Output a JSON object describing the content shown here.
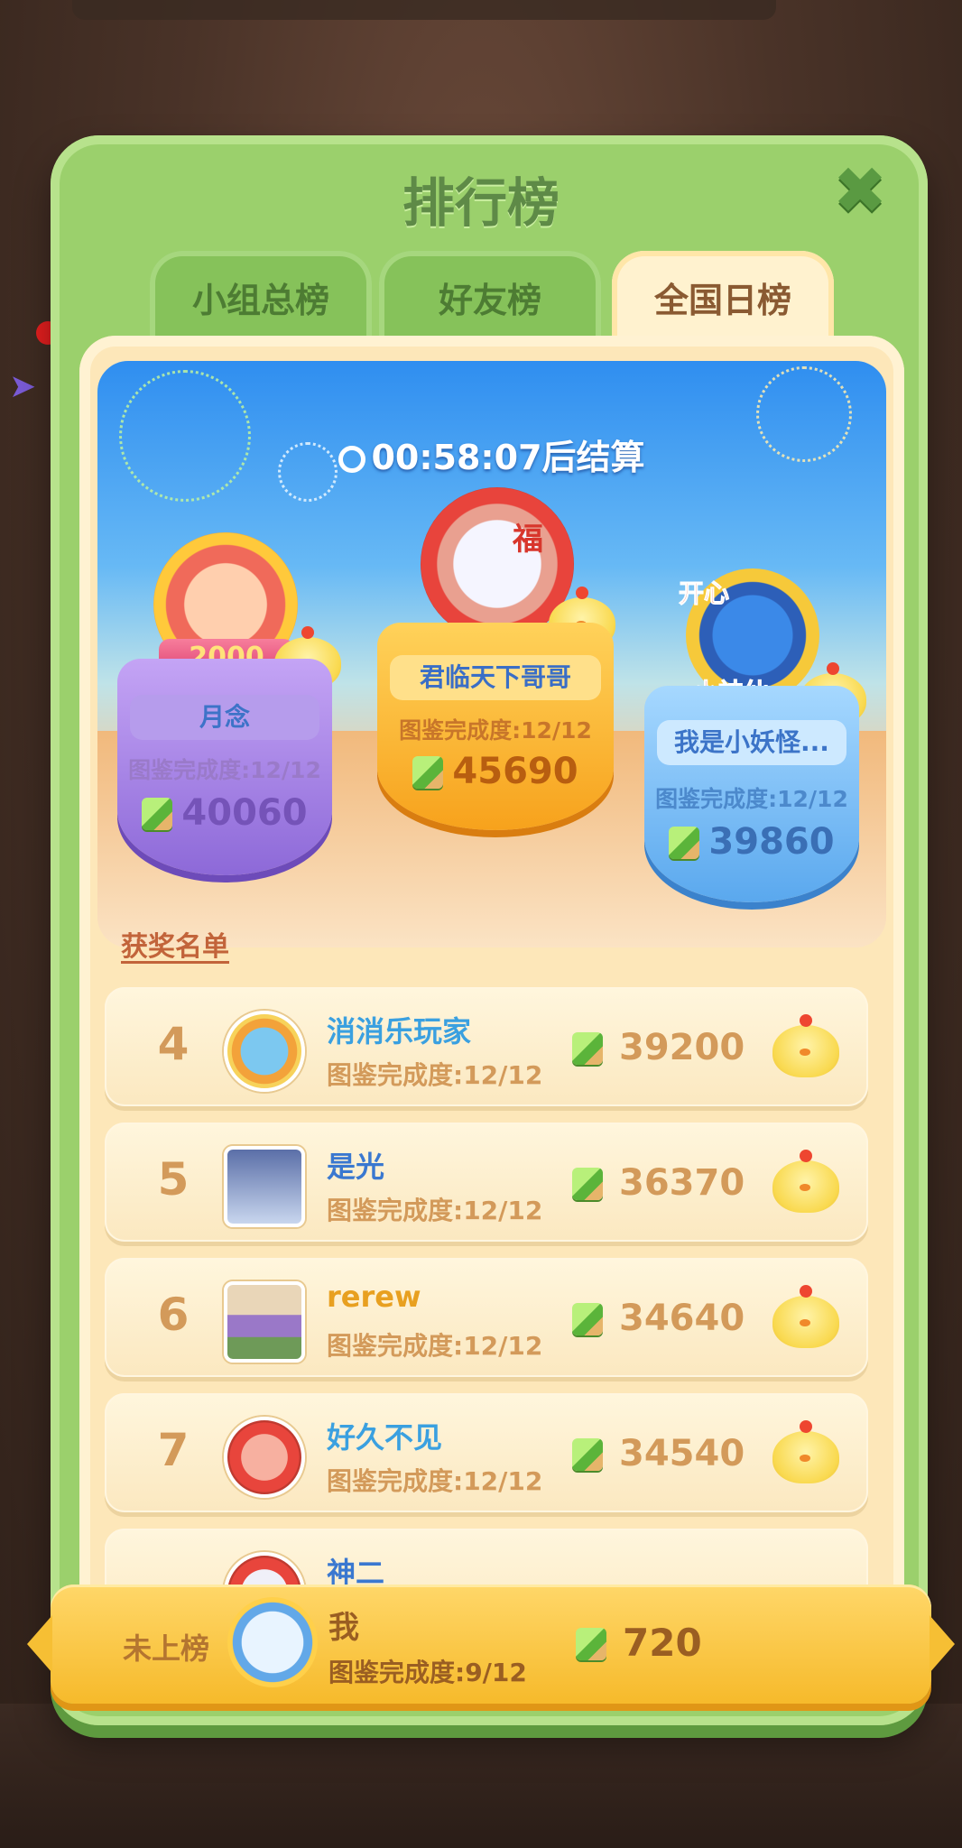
{
  "panel": {
    "title": "排行榜"
  },
  "tabs": [
    {
      "label": "小组总榜",
      "active": false
    },
    {
      "label": "好友榜",
      "active": false
    },
    {
      "label": "全国日榜",
      "active": true
    }
  ],
  "timer": {
    "text": "00:58:07后结算"
  },
  "podium": {
    "badges": {
      "second_ribbon": "2000",
      "first_mark": "福",
      "third_top": "开心",
      "third_bottom": "小神仙"
    },
    "top3": [
      {
        "rank": 2,
        "name": "月念",
        "progress": "图鉴完成度:12/12",
        "score": "40060"
      },
      {
        "rank": 1,
        "name": "君临天下哥哥",
        "progress": "图鉴完成度:12/12",
        "score": "45690"
      },
      {
        "rank": 3,
        "name": "我是小妖怪...",
        "progress": "图鉴完成度:12/12",
        "score": "39860"
      }
    ]
  },
  "winners_title": "获奖名单",
  "rows": [
    {
      "rank": "4",
      "name": "消消乐玩家",
      "progress": "图鉴完成度:12/12",
      "score": "39200"
    },
    {
      "rank": "5",
      "name": "是光",
      "progress": "图鉴完成度:12/12",
      "score": "36370"
    },
    {
      "rank": "6",
      "name": "rerew",
      "progress": "图鉴完成度:12/12",
      "score": "34640"
    },
    {
      "rank": "7",
      "name": "好久不见",
      "progress": "图鉴完成度:12/12",
      "score": "34540"
    },
    {
      "rank": "",
      "name": "神二",
      "progress": "",
      "score": ""
    }
  ],
  "me": {
    "status": "未上榜",
    "name": "我",
    "progress": "图鉴完成度:9/12",
    "score": "720"
  },
  "colors": {
    "panel": "#9bd06c",
    "tab_active": "#fff2cf",
    "gold": "#f6ba2b",
    "name_blue": "#3a6ec6"
  }
}
